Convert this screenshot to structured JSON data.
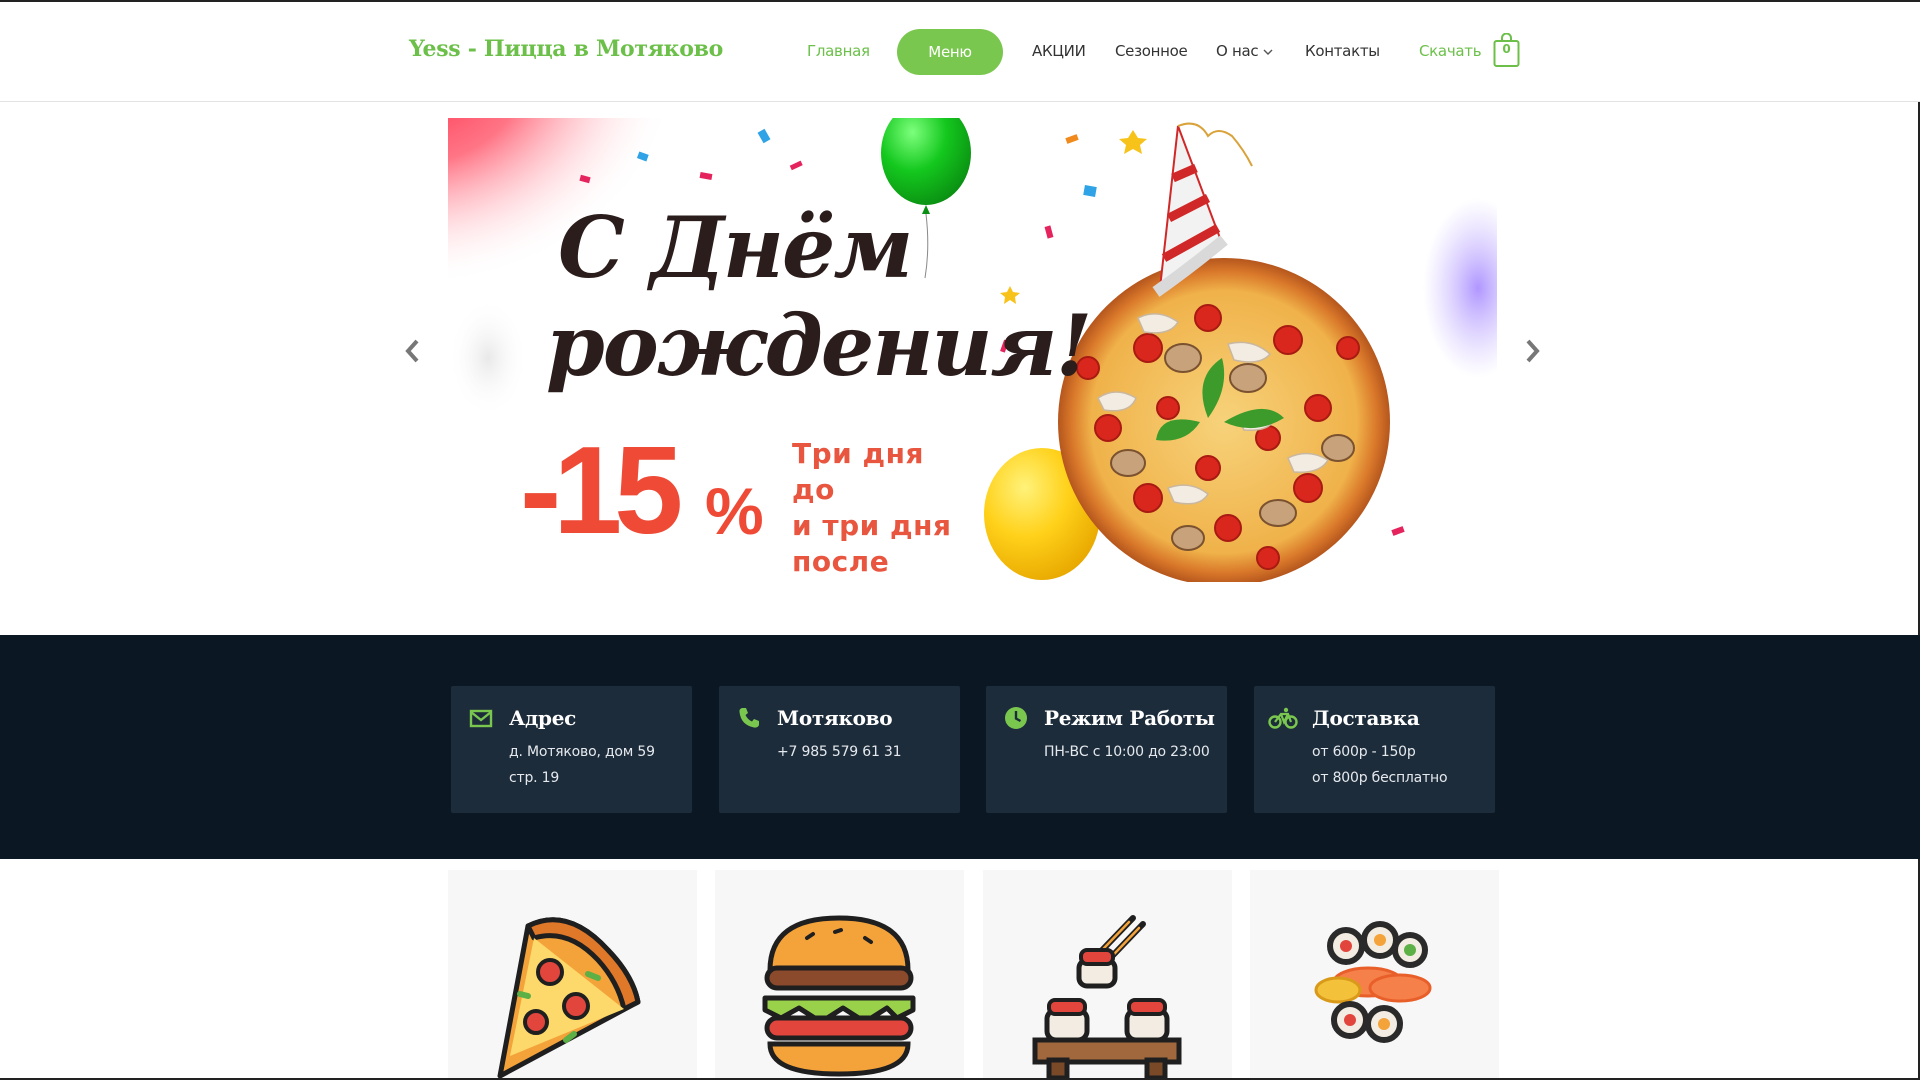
{
  "header": {
    "logo": "Yess - Пицца в Мотяково",
    "nav": {
      "home": "Главная",
      "menu": "Меню",
      "promos": "АКЦИИ",
      "seasonal": "Сезонное",
      "about": "О нас",
      "contacts": "Контакты",
      "download": "Скачать"
    },
    "cart_count": "0"
  },
  "slider": {
    "title_line1": "С Днём",
    "title_line2": "рождения!",
    "discount": "-15",
    "percent_sign": "%",
    "sub_line1": "Три дня до",
    "sub_line2": "и три дня",
    "sub_line3": "после"
  },
  "info": {
    "address": {
      "title": "Адрес",
      "line1": "д. Мотяково, дом 59",
      "line2": "стр. 19"
    },
    "phone": {
      "title": "Мотяково",
      "line1": "+7 985 579 61 31"
    },
    "hours": {
      "title": "Режим Работы",
      "line1": "ПН-ВС с 10:00 до 23:00"
    },
    "delivery": {
      "title": "Доставка",
      "line1": "от 600р - 150р",
      "line2": "от 800р бесплатно"
    }
  },
  "categories": [
    "pizza-icon",
    "burger-icon",
    "sushi-chopsticks-icon",
    "sushi-rolls-icon"
  ],
  "colors": {
    "accent": "#7ac74f",
    "dark_band": "#0b1823",
    "card": "#1d2c3a",
    "promo_red": "#ef4a36"
  }
}
